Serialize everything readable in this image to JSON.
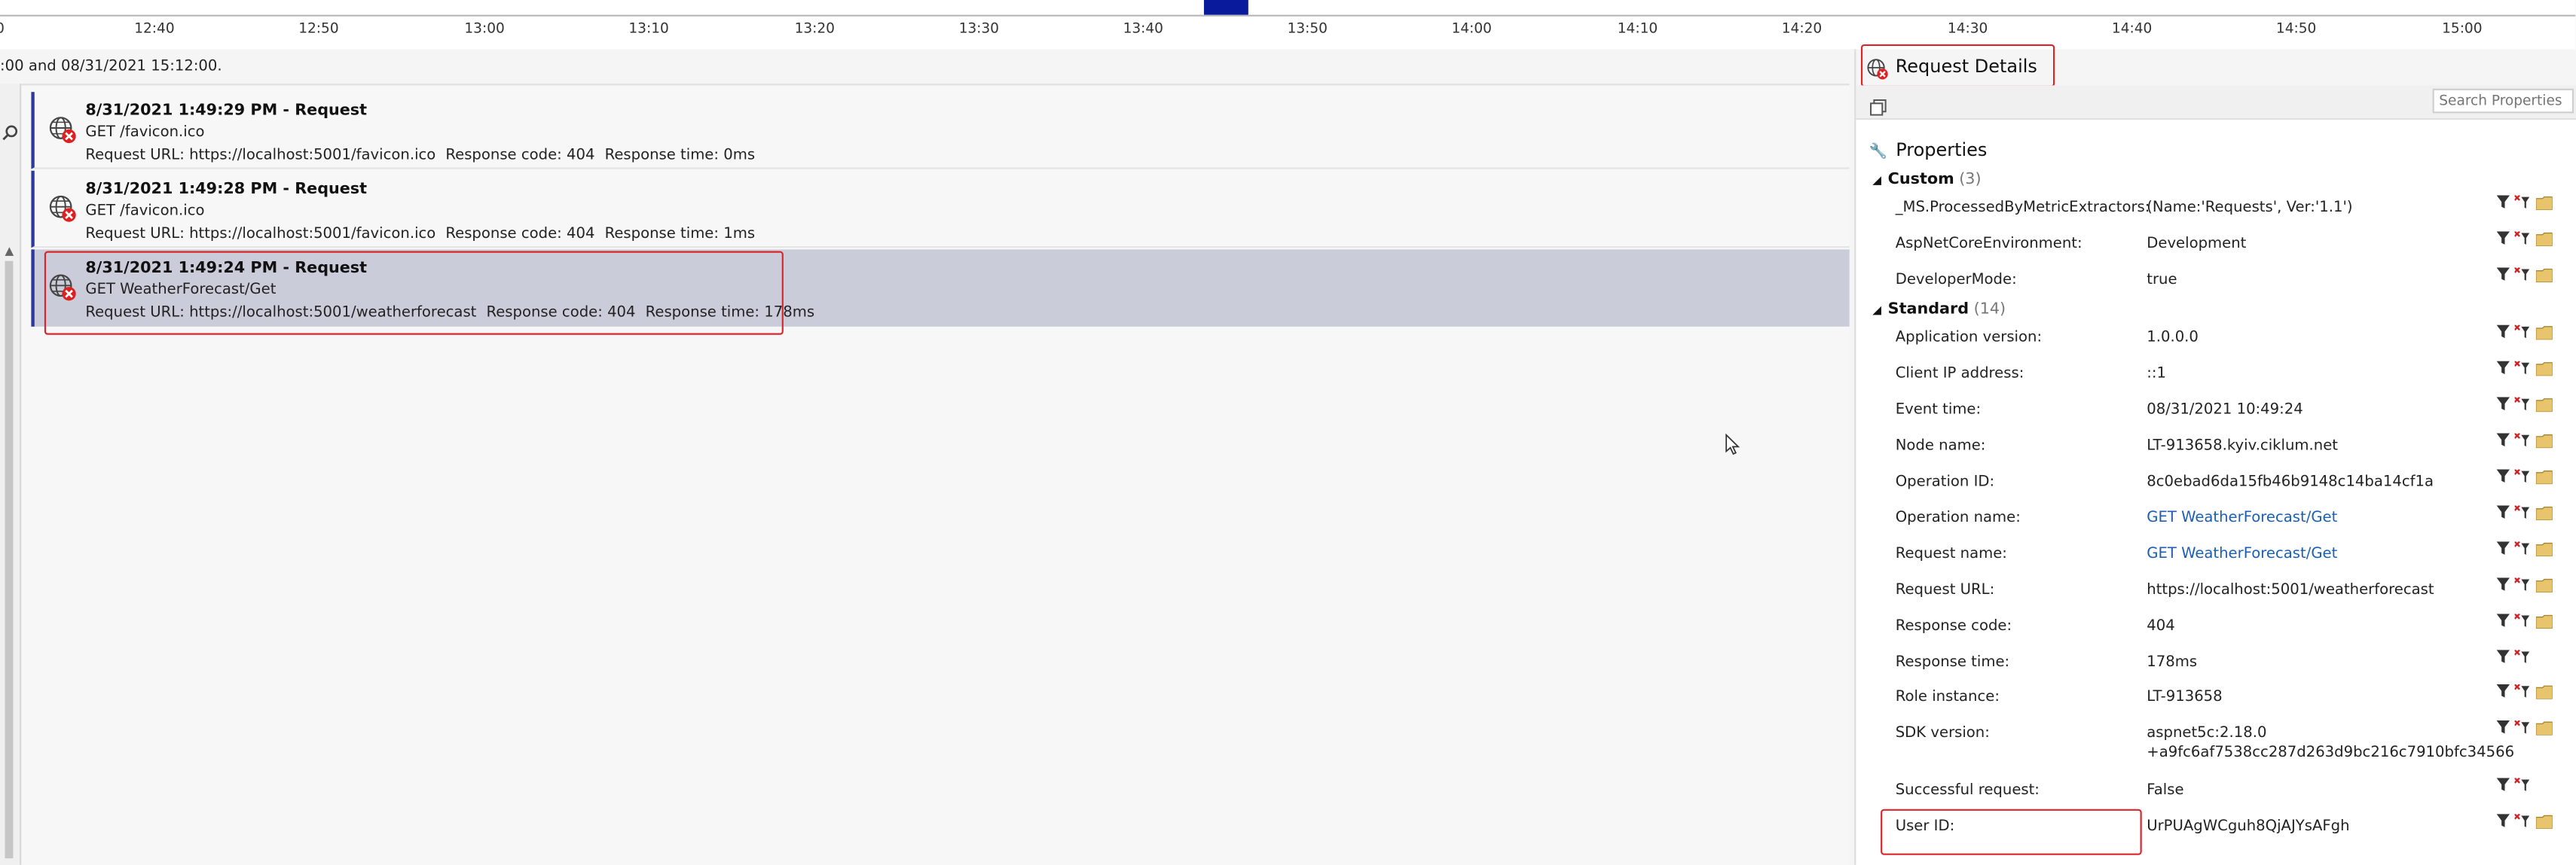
{
  "timeline": {
    "ticks": [
      "0",
      "12:40",
      "12:50",
      "13:00",
      "13:10",
      "13:20",
      "13:30",
      "13:40",
      "13:50",
      "14:00",
      "14:10",
      "14:20",
      "14:30",
      "14:40",
      "14:50",
      "15:00"
    ]
  },
  "range_text": ":00 and 08/31/2021 15:12:00.",
  "requests": [
    {
      "title": "8/31/2021 1:49:29 PM - Request",
      "line2": "GET /favicon.ico",
      "url": "Request URL: https://localhost:5001/favicon.ico",
      "code": "Response code: 404",
      "time": "Response time: 0ms"
    },
    {
      "title": "8/31/2021 1:49:28 PM - Request",
      "line2": "GET /favicon.ico",
      "url": "Request URL: https://localhost:5001/favicon.ico",
      "code": "Response code: 404",
      "time": "Response time: 1ms"
    },
    {
      "title": "8/31/2021 1:49:24 PM - Request",
      "line2": "GET WeatherForecast/Get",
      "url": "Request URL: https://localhost:5001/weatherforecast",
      "code": "Response code: 404",
      "time": "Response time: 178ms"
    }
  ],
  "details": {
    "title": "Request Details",
    "search_placeholder": "Search Properties",
    "properties_label": "Properties",
    "custom": {
      "label": "Custom",
      "count": "(3)",
      "rows": [
        {
          "key": "_MS.ProcessedByMetricExtractors:",
          "value": "(Name:'Requests', Ver:'1.1')"
        },
        {
          "key": "AspNetCoreEnvironment:",
          "value": "Development"
        },
        {
          "key": "DeveloperMode:",
          "value": "true"
        }
      ]
    },
    "standard": {
      "label": "Standard",
      "count": "(14)",
      "rows": [
        {
          "key": "Application version:",
          "value": "1.0.0.0"
        },
        {
          "key": "Client IP address:",
          "value": "::1"
        },
        {
          "key": "Event time:",
          "value": "08/31/2021 10:49:24"
        },
        {
          "key": "Node name:",
          "value": "LT-913658.kyiv.ciklum.net"
        },
        {
          "key": "Operation ID:",
          "value": "8c0ebad6da15fb46b9148c14ba14cf1a"
        },
        {
          "key": "Operation name:",
          "value": "GET WeatherForecast/Get"
        },
        {
          "key": "Request name:",
          "value": "GET WeatherForecast/Get"
        },
        {
          "key": "Request URL:",
          "value": "https://localhost:5001/weatherforecast"
        },
        {
          "key": "Response code:",
          "value": "404"
        },
        {
          "key": "Response time:",
          "value": "178ms"
        },
        {
          "key": "Role instance:",
          "value": "LT-913658"
        },
        {
          "key": "SDK version:",
          "value": "aspnet5c:2.18.0",
          "value2": "+a9fc6af7538cc287d263d9bc216c7910bfc34566"
        },
        {
          "key": "Successful request:",
          "value": "False"
        },
        {
          "key": "User ID:",
          "value": "UrPUAgWCguh8QjAJYsAFgh"
        }
      ]
    }
  },
  "colors": {
    "accent_marker": "#0a1a9c",
    "selected_row": "#cacdd9",
    "highlight_box": "#d9262c",
    "link": "#1a5fb4"
  }
}
